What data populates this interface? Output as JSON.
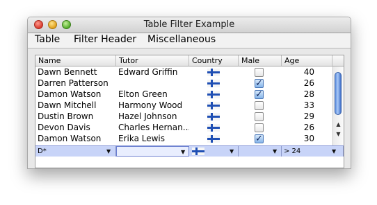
{
  "window": {
    "title": "Table Filter Example"
  },
  "menu": [
    "Table",
    "Filter Header",
    "Miscellaneous"
  ],
  "columns": [
    "Name",
    "Tutor",
    "Country",
    "Male",
    "Age"
  ],
  "rows": [
    {
      "name": "Dawn Bennett",
      "tutor": "Edward Griffin",
      "country": "finland-flag-icon",
      "male": false,
      "age": "40"
    },
    {
      "name": "Darren Patterson",
      "tutor": "",
      "country": "finland-flag-icon",
      "male": true,
      "age": "26"
    },
    {
      "name": "Damon Watson",
      "tutor": "Elton Green",
      "country": "finland-flag-icon",
      "male": true,
      "age": "28"
    },
    {
      "name": "Dawn Mitchell",
      "tutor": "Harmony Wood",
      "country": "finland-flag-icon",
      "male": false,
      "age": "33"
    },
    {
      "name": "Dustin Brown",
      "tutor": "Hazel Johnson",
      "country": "finland-flag-icon",
      "male": false,
      "age": "29"
    },
    {
      "name": "Devon Davis",
      "tutor": "Charles Hernan...",
      "country": "finland-flag-icon",
      "male": false,
      "age": "26"
    },
    {
      "name": "Damon Watson",
      "tutor": "Erika Lewis",
      "country": "finland-flag-icon",
      "male": true,
      "age": "30"
    }
  ],
  "filters": {
    "name": "D*",
    "tutor": "",
    "country": "finland-flag-icon",
    "male": "",
    "age": "> 24"
  },
  "colors": {
    "filter_bg": "#c8d4f8",
    "check_on": "#86b5ea",
    "flag_blue": "#1f4fb4"
  }
}
